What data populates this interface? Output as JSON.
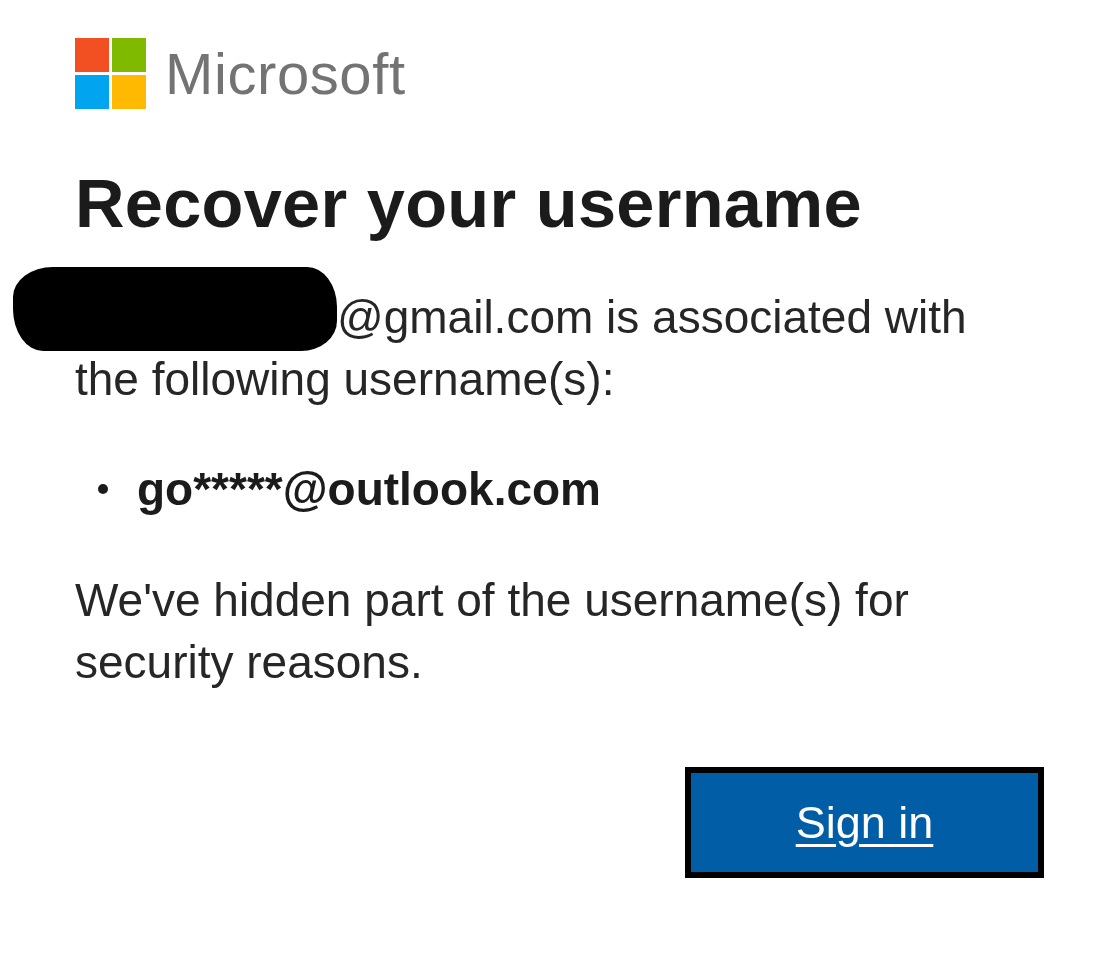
{
  "brand": {
    "name": "Microsoft"
  },
  "title": "Recover your username",
  "message": {
    "redacted": true,
    "text": "@gmail.com is associated with the following username(s):"
  },
  "usernames": [
    "go*****@outlook.com"
  ],
  "note": "We've hidden part of the username(s) for security reasons.",
  "buttons": [
    {
      "label": "Sign in",
      "kind": "primary"
    }
  ]
}
